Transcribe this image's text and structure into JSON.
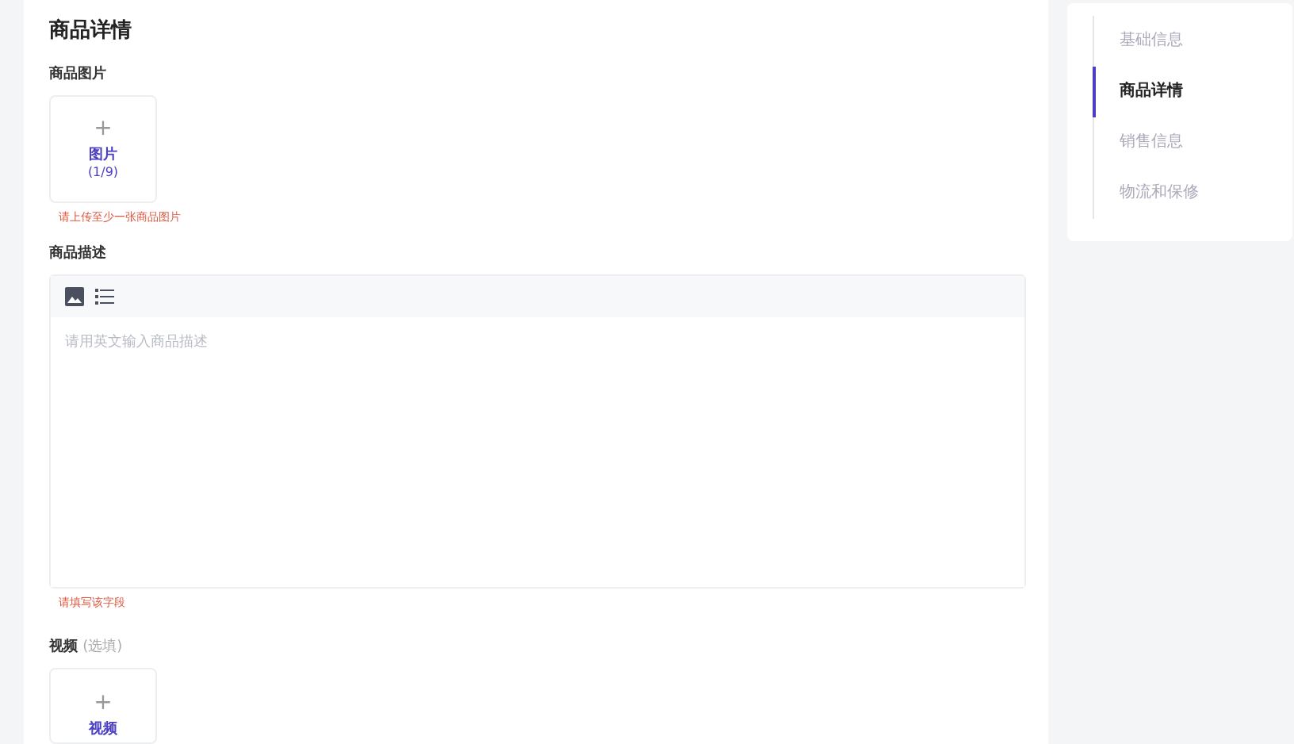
{
  "section_title": "商品详情",
  "images": {
    "label": "商品图片",
    "upload": {
      "plus": "+",
      "label": "图片",
      "count": "(1/9)"
    },
    "error": "请上传至少一张商品图片"
  },
  "description": {
    "label": "商品描述",
    "placeholder": "请用英文输入商品描述",
    "error": "请填写该字段"
  },
  "video": {
    "label": "视频",
    "hint": "(选填)",
    "upload": {
      "plus": "+",
      "label": "视频"
    }
  },
  "nav": [
    {
      "label": "基础信息",
      "selected": false
    },
    {
      "label": "商品详情",
      "selected": true
    },
    {
      "label": "销售信息",
      "selected": false
    },
    {
      "label": "物流和保修",
      "selected": false
    }
  ]
}
